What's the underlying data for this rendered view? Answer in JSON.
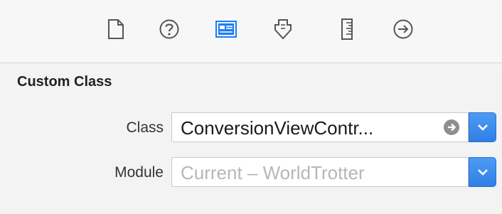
{
  "inspector_tabs": [
    {
      "icon": "file-inspector-icon",
      "selected": false
    },
    {
      "icon": "quick-help-icon",
      "selected": false
    },
    {
      "icon": "identity-inspector-icon",
      "selected": true
    },
    {
      "icon": "attributes-inspector-icon",
      "selected": false
    },
    {
      "icon": "size-inspector-icon",
      "selected": false
    },
    {
      "icon": "connections-inspector-icon",
      "selected": false
    }
  ],
  "accent_color": "#2f7fe6",
  "custom_class": {
    "section_title": "Custom Class",
    "class_label": "Class",
    "class_value": "ConversionViewContr...",
    "module_label": "Module",
    "module_placeholder": "Current – WorldTrotter"
  }
}
